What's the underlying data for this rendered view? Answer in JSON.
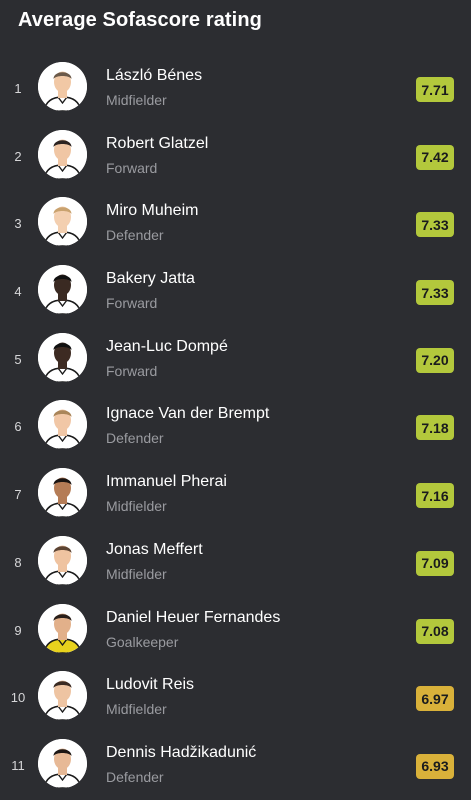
{
  "title": "Average Sofascore rating",
  "colors": {
    "good": "#b3c83c",
    "ok": "#d9b13a"
  },
  "players": [
    {
      "rank": "1",
      "name": "László Bénes",
      "position": "Midfielder",
      "rating": "7.71",
      "tier": "good",
      "skin": "#f1c8a5",
      "hair": "#6b5a4a",
      "kit": "#ffffff"
    },
    {
      "rank": "2",
      "name": "Robert Glatzel",
      "position": "Forward",
      "rating": "7.42",
      "tier": "good",
      "skin": "#f0c6a4",
      "hair": "#2b2321",
      "kit": "#ffffff"
    },
    {
      "rank": "3",
      "name": "Miro Muheim",
      "position": "Defender",
      "rating": "7.33",
      "tier": "good",
      "skin": "#f3cfb0",
      "hair": "#c9a26f",
      "kit": "#ffffff"
    },
    {
      "rank": "4",
      "name": "Bakery Jatta",
      "position": "Forward",
      "rating": "7.33",
      "tier": "good",
      "skin": "#3a2a22",
      "hair": "#111111",
      "kit": "#ffffff"
    },
    {
      "rank": "5",
      "name": "Jean-Luc Dompé",
      "position": "Forward",
      "rating": "7.20",
      "tier": "good",
      "skin": "#3d2b22",
      "hair": "#111111",
      "kit": "#ffffff"
    },
    {
      "rank": "6",
      "name": "Ignace Van der Brempt",
      "position": "Defender",
      "rating": "7.18",
      "tier": "good",
      "skin": "#f1c7a6",
      "hair": "#a98559",
      "kit": "#ffffff"
    },
    {
      "rank": "7",
      "name": "Immanuel Pherai",
      "position": "Midfielder",
      "rating": "7.16",
      "tier": "good",
      "skin": "#b57c56",
      "hair": "#1a1412",
      "kit": "#ffffff"
    },
    {
      "rank": "8",
      "name": "Jonas Meffert",
      "position": "Midfielder",
      "rating": "7.09",
      "tier": "good",
      "skin": "#efc3a0",
      "hair": "#5c4433",
      "kit": "#ffffff"
    },
    {
      "rank": "9",
      "name": "Daniel Heuer Fernandes",
      "position": "Goalkeeper",
      "rating": "7.08",
      "tier": "good",
      "skin": "#e2b08a",
      "hair": "#2a1f1a",
      "kit": "#e8d21d"
    },
    {
      "rank": "10",
      "name": "Ludovit Reis",
      "position": "Midfielder",
      "rating": "6.97",
      "tier": "ok",
      "skin": "#eec4a2",
      "hair": "#3a2a22",
      "kit": "#ffffff"
    },
    {
      "rank": "11",
      "name": "Dennis Hadžikadunić",
      "position": "Defender",
      "rating": "6.93",
      "tier": "ok",
      "skin": "#e7b996",
      "hair": "#1d1715",
      "kit": "#ffffff"
    }
  ]
}
